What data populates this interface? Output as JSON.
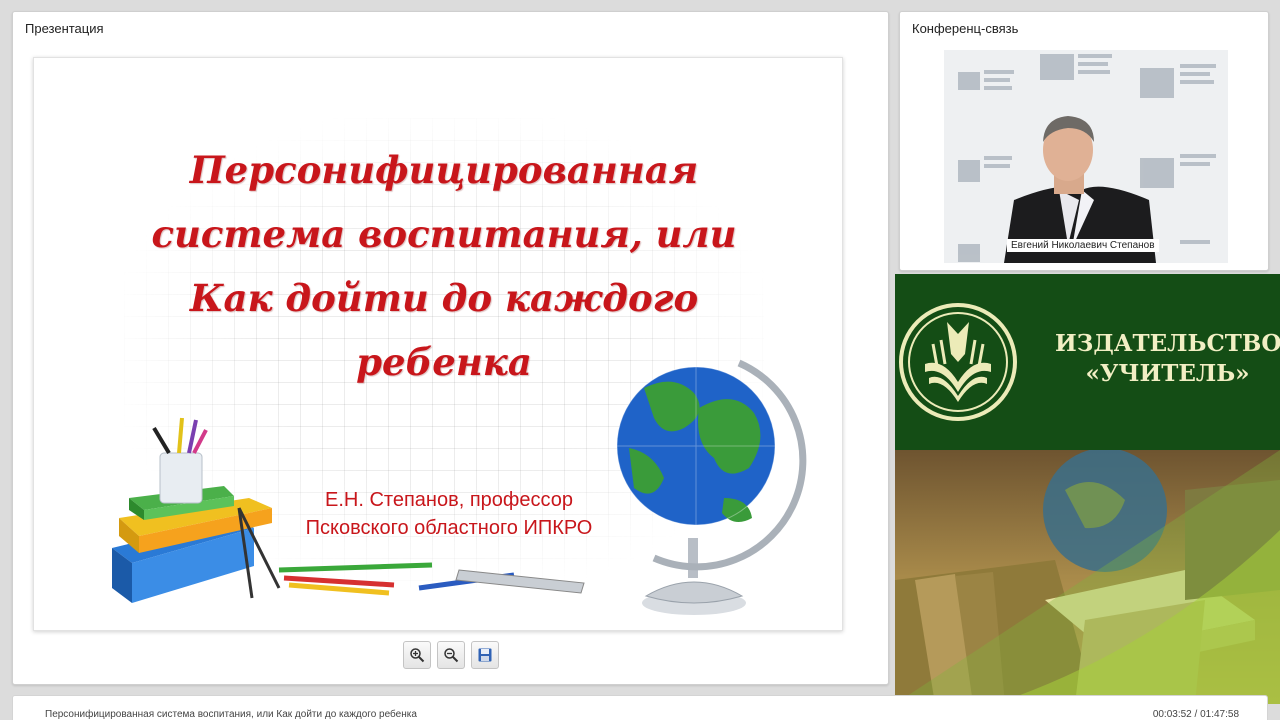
{
  "presentation": {
    "panel_title": "Презентация",
    "slide": {
      "title_lines": [
        "Персонифицированная",
        "система воспитания, или",
        "Как дойти до каждого",
        "ребенка"
      ],
      "author_lines": [
        "Е.Н. Степанов, профессор",
        "Псковского областного ИПКРО"
      ],
      "accent_color": "#c8161b"
    },
    "toolbar": {
      "zoom_in": "zoom-in-icon",
      "zoom_out": "zoom-out-icon",
      "save": "save-icon"
    }
  },
  "conference": {
    "panel_title": "Конференц-связь",
    "speaker_name": "Евгений Николаевич Степанов"
  },
  "banner": {
    "name_lines": [
      "ИЗДАТЕЛЬСТВО",
      "«УЧИТЕЛЬ»"
    ],
    "brand_color": "#144d15"
  },
  "footer": {
    "title": "Персонифицированная система воспитания, или Как дойти до каждого ребенка",
    "time": "00:03:52 / 01:47:58"
  }
}
